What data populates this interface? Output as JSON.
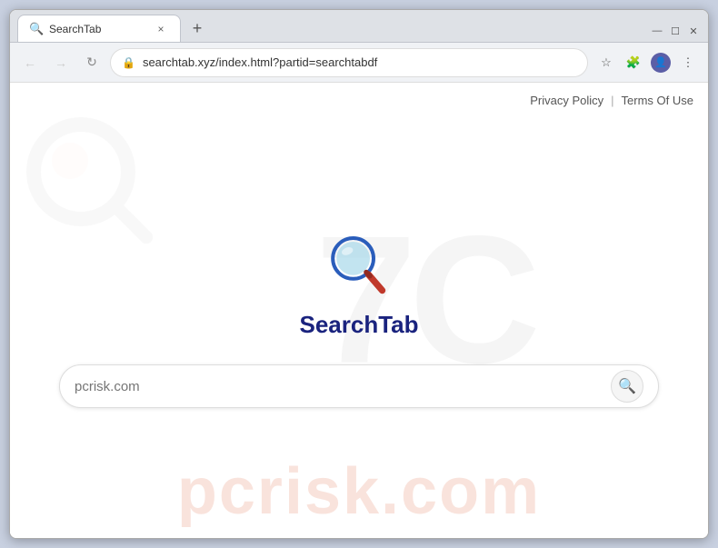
{
  "browser": {
    "tab_title": "SearchTab",
    "tab_favicon": "🔍",
    "close_label": "×",
    "new_tab_label": "+",
    "window_minimize": "—",
    "window_maximize": "☐",
    "window_close": "✕"
  },
  "addressbar": {
    "back_icon": "←",
    "forward_icon": "→",
    "reload_icon": "↻",
    "lock_icon": "🔒",
    "url": "searchtab.xyz/index.html?partid=searchtabdf",
    "star_icon": "☆",
    "extensions_icon": "🧩",
    "profile_icon": "👤",
    "menu_icon": "⋮"
  },
  "page": {
    "privacy_policy_label": "Privacy Policy",
    "separator": "|",
    "terms_of_use_label": "Terms Of Use",
    "brand_name": "SearchTab",
    "search_placeholder": "pcrisk.com",
    "search_icon": "🔍",
    "watermark_text": "7C",
    "watermark_brand": "pcrisk.com"
  }
}
